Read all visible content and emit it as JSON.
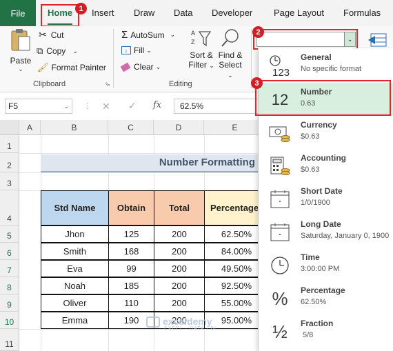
{
  "tabs": [
    {
      "label": "File"
    },
    {
      "label": "Home"
    },
    {
      "label": "Insert"
    },
    {
      "label": "Draw"
    },
    {
      "label": "Data"
    },
    {
      "label": "Developer"
    },
    {
      "label": "Page Layout"
    },
    {
      "label": "Formulas"
    }
  ],
  "badges": {
    "home": "1",
    "dropdown": "2",
    "number": "3"
  },
  "clipboard": {
    "paste": "Paste",
    "cut": "Cut",
    "copy": "Copy",
    "format_painter": "Format Painter",
    "group": "Clipboard"
  },
  "editing": {
    "autosum": "AutoSum",
    "fill": "Fill",
    "clear": "Clear",
    "sort_filter_1": "Sort &",
    "sort_filter_2": "Filter",
    "find_select_1": "Find &",
    "find_select_2": "Select",
    "group": "Editing"
  },
  "formula_bar": {
    "name_box": "F5",
    "fx": "fx",
    "value": "62.5%"
  },
  "grid": {
    "columns": [
      "A",
      "B",
      "C",
      "D",
      "E"
    ],
    "rows": [
      "1",
      "2",
      "3",
      "4",
      "5",
      "6",
      "7",
      "8",
      "9",
      "10",
      "11"
    ],
    "title": "Number Formatting",
    "headers": [
      "Std Name",
      "Obtain",
      "Total",
      "Percentage"
    ],
    "records": [
      {
        "name": "Jhon",
        "obtain": "125",
        "total": "200",
        "pct": "62.50%"
      },
      {
        "name": "Smith",
        "obtain": "168",
        "total": "200",
        "pct": "84.00%"
      },
      {
        "name": "Eva",
        "obtain": "99",
        "total": "200",
        "pct": "49.50%"
      },
      {
        "name": "Noah",
        "obtain": "185",
        "total": "200",
        "pct": "92.50%"
      },
      {
        "name": "Oliver",
        "obtain": "110",
        "total": "200",
        "pct": "55.00%"
      },
      {
        "name": "Emma",
        "obtain": "190",
        "total": "200",
        "pct": "95.00%"
      }
    ]
  },
  "formats": [
    {
      "name": "General",
      "sample": "No specific format",
      "icon": "general-123-icon",
      "glyph": "123"
    },
    {
      "name": "Number",
      "sample": "0.63",
      "icon": "number-12-icon",
      "glyph": "12"
    },
    {
      "name": "Currency",
      "sample": "$0.63",
      "icon": "currency-icon"
    },
    {
      "name": "Accounting",
      "sample": "$0.63",
      "icon": "accounting-icon"
    },
    {
      "name": "Short Date",
      "sample": "1/0/1900",
      "icon": "calendar-icon"
    },
    {
      "name": "Long Date",
      "sample": "Saturday, January 0, 1900",
      "icon": "calendar-icon"
    },
    {
      "name": "Time",
      "sample": "3:00:00 PM",
      "icon": "clock-icon"
    },
    {
      "name": "Percentage",
      "sample": "62.50%",
      "icon": "percent-icon",
      "glyph": "%"
    },
    {
      "name": "Fraction",
      "sample": "5/8",
      "icon": "fraction-icon",
      "glyph": "½"
    }
  ],
  "watermark": {
    "brand": "exceldemy",
    "tagline": "EXCEL · DATA · BI"
  },
  "colors": {
    "excel_green": "#217346",
    "highlight_red": "#e0262c",
    "header_blue": "#bdd7ee",
    "header_orange": "#f8cbad",
    "header_yellow": "#fff2cc",
    "number_highlight": "#d8efe0"
  }
}
